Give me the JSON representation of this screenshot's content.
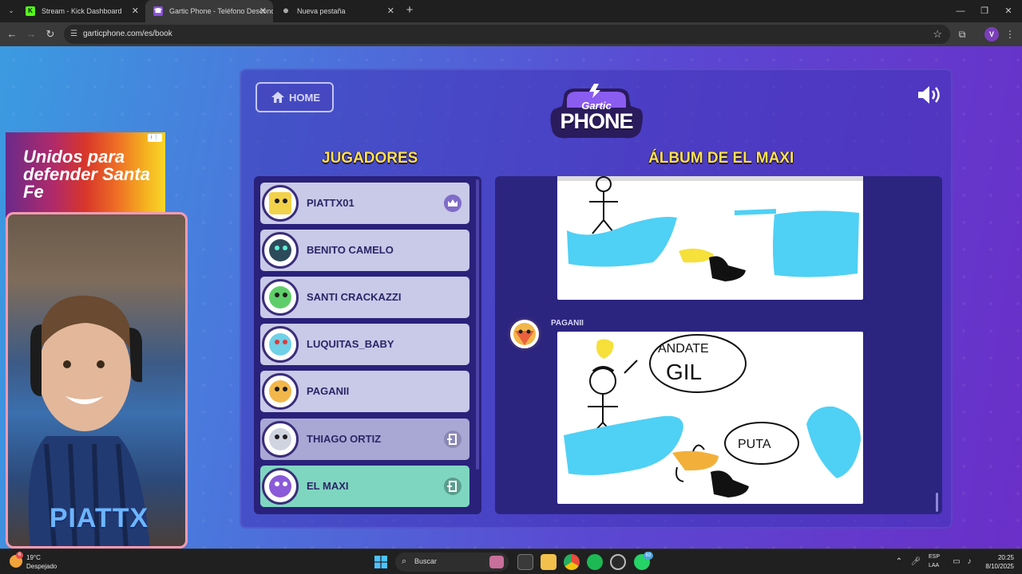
{
  "browser": {
    "tabs": [
      {
        "title": "Stream - Kick Dashboard",
        "favicon": "K",
        "active": false
      },
      {
        "title": "Gartic Phone - Teléfono Desconocido",
        "favicon": "☎",
        "active": true
      },
      {
        "title": "Nueva pestaña",
        "favicon": "⊕",
        "active": false
      }
    ],
    "url": "garticphone.com/es/book",
    "profile_initial": "V"
  },
  "game": {
    "home_label": "HOME",
    "logo_line1": "Gartic",
    "logo_line2": "PHONE",
    "players_title": "JUGADORES",
    "album_title": "ÁLBUM DE EL MAXI",
    "players": [
      {
        "name": "PIATTX01",
        "badge": "crown-icon"
      },
      {
        "name": "BENITO CAMELO",
        "badge": ""
      },
      {
        "name": "SANTI CRACKAZZI",
        "badge": ""
      },
      {
        "name": "LUQUITAS_BABY",
        "badge": ""
      },
      {
        "name": "PAGANII",
        "badge": ""
      },
      {
        "name": "THIAGO ORTIZ",
        "badge": "exit-icon"
      },
      {
        "name": "EL MAXI",
        "badge": "exit-icon"
      }
    ],
    "album_author": "PAGANII",
    "drawing2_text_1": "ANDATE",
    "drawing2_text_2": "GIL",
    "drawing2_text_3": "PUTA"
  },
  "overlay": {
    "ad_text": "Unidos para defender Santa Fe",
    "ad_info": "i ⋮",
    "streamer_label": "PIATTX"
  },
  "taskbar": {
    "weather_temp": "19°C",
    "weather_condition": "Despejado",
    "weather_badge": "6",
    "search_label": "Buscar",
    "whatsapp_badge": "63",
    "lang_line1": "ESP",
    "lang_line2": "LAA",
    "time": "20:25",
    "date": "8/10/2025"
  },
  "colors": {
    "accent_yellow": "#ffe14a",
    "player_card": "#c9c9e8",
    "player_current": "#7fd6c0",
    "panel_dark": "#29217a",
    "drawing_blue": "#4fd0f5"
  }
}
